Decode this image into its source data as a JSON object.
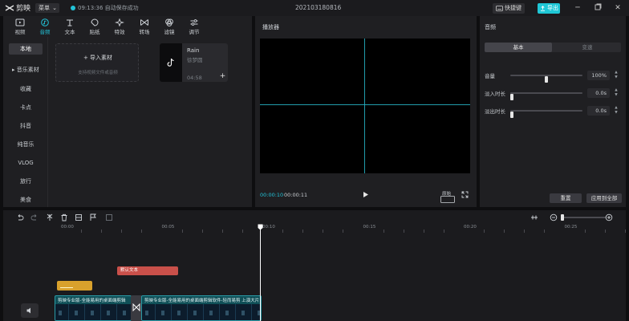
{
  "titlebar": {
    "app_name": "剪映",
    "menu_label": "菜单",
    "save_status": "09:13:36 自动保存成功",
    "project_title": "202103180816",
    "shortcut_label": "快捷键",
    "export_label": "导出"
  },
  "media": {
    "tabs": [
      {
        "label": "视频"
      },
      {
        "label": "音频"
      },
      {
        "label": "文本"
      },
      {
        "label": "贴纸"
      },
      {
        "label": "特效"
      },
      {
        "label": "转场"
      },
      {
        "label": "滤镜"
      },
      {
        "label": "调节"
      }
    ],
    "active_tab": "音频",
    "sidebar": [
      {
        "label": "本地"
      },
      {
        "label": "▸ 音乐素材"
      },
      {
        "label": "收藏"
      },
      {
        "label": "卡点"
      },
      {
        "label": "抖音"
      },
      {
        "label": "纯音乐"
      },
      {
        "label": "VLOG"
      },
      {
        "label": "旅行"
      },
      {
        "label": "美食"
      }
    ],
    "import_label": "+ 导入素材",
    "import_hint": "支持视频文件或音频",
    "music_item": {
      "title": "Rain",
      "artist": "徐梦圆",
      "duration": "04:58"
    }
  },
  "player": {
    "title": "播放器",
    "current_time": "00:00:10",
    "total_time": "00:00:11",
    "ratio_label": "原始"
  },
  "properties": {
    "title": "音频",
    "tab_basic": "基本",
    "tab_speed": "变速",
    "rows": [
      {
        "label": "音量",
        "value": "100%",
        "level": 0.5
      },
      {
        "label": "淡入时长",
        "value": "0.0s",
        "level": 0
      },
      {
        "label": "淡出时长",
        "value": "0.0s",
        "level": 0
      }
    ],
    "reset_label": "重置",
    "apply_all_label": "应用到全部"
  },
  "timeline": {
    "ruler": [
      {
        "label": "00:00",
        "sec": 0
      },
      {
        "label": "00:05",
        "sec": 5
      },
      {
        "label": "00:10",
        "sec": 10
      },
      {
        "label": "00:15",
        "sec": 15
      },
      {
        "label": "00:20",
        "sec": 20
      },
      {
        "label": "00:25",
        "sec": 25
      }
    ],
    "text_clip": "默认文本",
    "video_clip_1": "剪映专业版-全能易用的桌面端剪辑",
    "video_clip_2": "剪映专业版-全能易用的桌面端剪辑软件-轻而易剪 上演大片"
  },
  "colors": {
    "accent": "#22c3d8",
    "text_clip": "#c9504a",
    "sticker_clip": "#d9a12c",
    "video_clip": "#0f4f57"
  }
}
